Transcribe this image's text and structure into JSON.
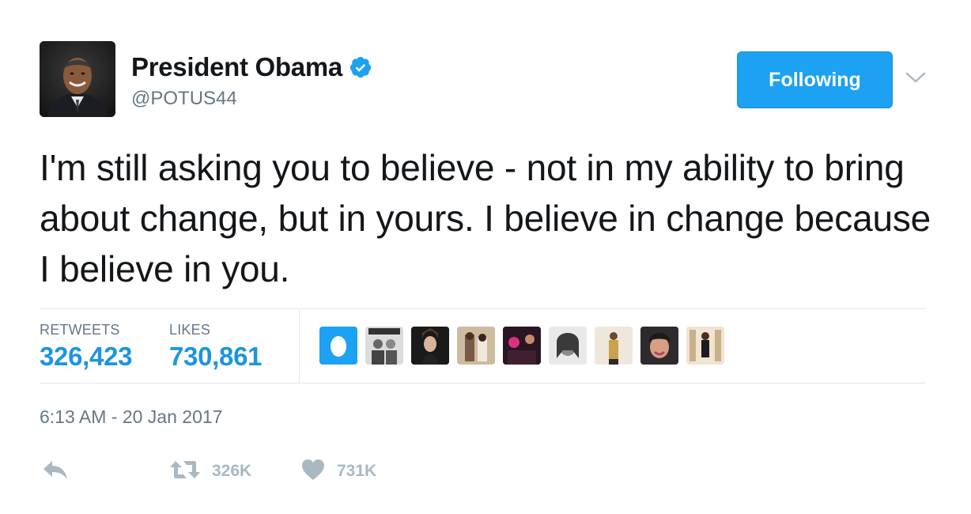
{
  "author": {
    "display_name": "President Obama",
    "handle": "@POTUS44",
    "verified": true,
    "avatar_icon": "avatar-photo"
  },
  "follow_button": {
    "label": "Following"
  },
  "more_icon": "chevron-down-icon",
  "tweet": {
    "text": "I'm still asking you to believe - not in my ability to bring about change, but in yours. I believe in change because I believe in you."
  },
  "stats": {
    "retweets_label": "RETWEETS",
    "retweets_value": "326,423",
    "likes_label": "LIKES",
    "likes_value": "730,861"
  },
  "likers": [
    {
      "name": "liker-egg-avatar"
    },
    {
      "name": "liker-avatar-2"
    },
    {
      "name": "liker-avatar-3"
    },
    {
      "name": "liker-avatar-4"
    },
    {
      "name": "liker-avatar-5"
    },
    {
      "name": "liker-avatar-6"
    },
    {
      "name": "liker-avatar-7"
    },
    {
      "name": "liker-avatar-8"
    },
    {
      "name": "liker-avatar-9"
    }
  ],
  "timestamp": "6:13 AM - 20 Jan 2017",
  "actions": {
    "reply_icon": "reply-icon",
    "retweet_icon": "retweet-icon",
    "retweet_count": "326K",
    "like_icon": "heart-icon",
    "like_count": "731K"
  },
  "colors": {
    "accent": "#1da1f2",
    "stat_value": "#1b95e0",
    "muted": "#657786",
    "action_gray": "#aab8c2"
  }
}
